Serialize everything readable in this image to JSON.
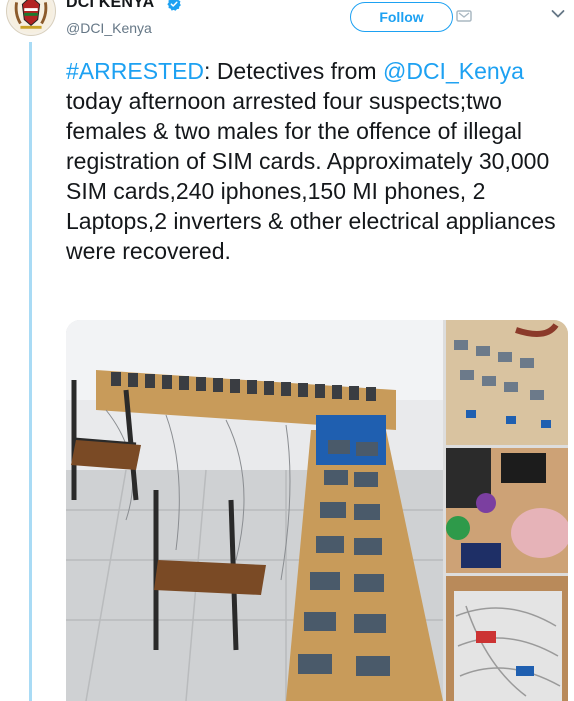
{
  "profile": {
    "display_name": "DCI KENYA",
    "handle": "@DCI_Kenya",
    "verified": true,
    "avatar_icon": "kenya-coat-of-arms-icon"
  },
  "actions": {
    "follow_label": "Follow"
  },
  "tweet": {
    "hashtag": "#ARRESTED",
    "part1": ": Detectives from ",
    "mention": "@DCI_Kenya",
    "part2": " today afternoon arrested four suspects;two females & two males for the offence of illegal registration of SIM cards. Approximately 30,000 SIM cards,240 iphones,150 MI phones, 2 Laptops,2 inverters & other electrical appliances were recovered."
  },
  "colors": {
    "accent": "#1da1f2",
    "thread_line": "#a9dbf5",
    "text": "#14171a",
    "muted": "#657786"
  },
  "media": {
    "photo_count": 4
  }
}
